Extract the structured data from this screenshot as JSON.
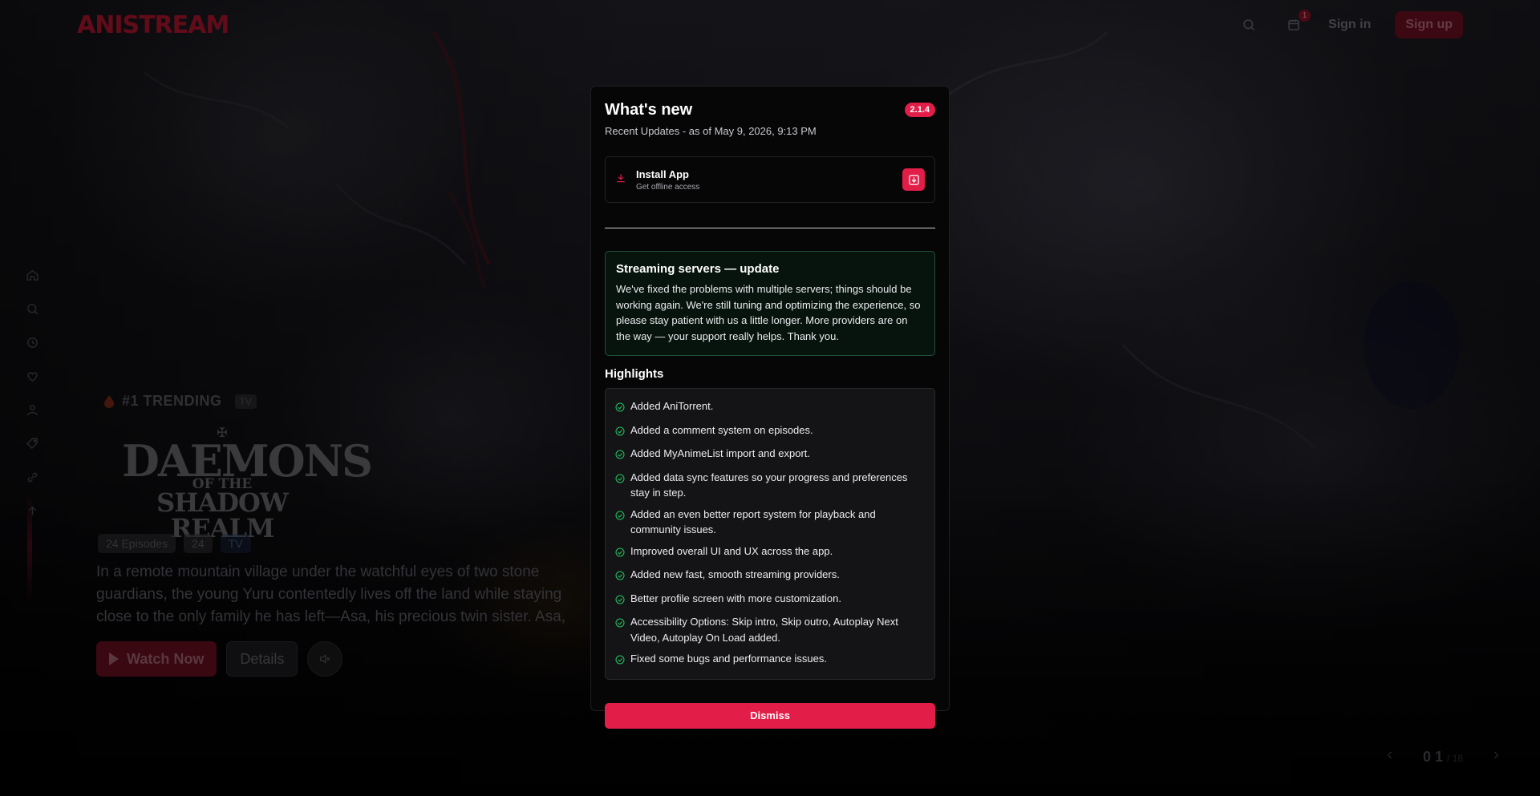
{
  "app": {
    "logo": "ANISTREAM",
    "accent": "#e11d48"
  },
  "header": {
    "notification_count": "1",
    "signin_label": "Sign in",
    "signup_label": "Sign up"
  },
  "hero": {
    "trending_label": "#1 TRENDING",
    "type_chip": "TV",
    "title_lines": [
      "DAEMONS",
      "OF THE",
      "SHADOW REALM"
    ],
    "meta": [
      "24 Episodes",
      "24",
      "TV"
    ],
    "synopsis": "In a remote mountain village under the watchful eyes of two stone guardians, the young Yuru contentedly lives off the land while staying close to the only family he has left—Asa, his precious twin sister. Asa, meanwhile",
    "watch_label": "Watch Now",
    "details_label": "Details"
  },
  "pager": {
    "current": "0 1",
    "total": "/ 18"
  },
  "modal": {
    "title": "What's new",
    "version": "2.1.4",
    "subtitle": "Recent Updates - as of May 9, 2026, 9:13 PM",
    "install": {
      "title": "Install App",
      "desc": "Get offline access"
    },
    "notice": {
      "title": "Streaming servers — update",
      "body": "We've fixed the problems with multiple servers; things should be working again. We're still tuning and optimizing the experience, so please stay patient with us a little longer. More providers are on the way — your support really helps. Thank you."
    },
    "highlights_heading": "Highlights",
    "highlights": [
      "Added AniTorrent.",
      "Added a comment system on episodes.",
      "Added MyAnimeList import and export.",
      "Added data sync features so your progress and preferences stay in step.",
      "Added an even better report system for playback and community issues.",
      "Improved overall UI and UX across the app.",
      "Added new fast, smooth streaming providers.",
      "Better profile screen with more customization.",
      "Accessibility Options: Skip intro, Skip outro, Autoplay Next Video, Autoplay On Load added.",
      "Fixed some bugs and performance issues."
    ],
    "dismiss_label": "Dismiss"
  }
}
